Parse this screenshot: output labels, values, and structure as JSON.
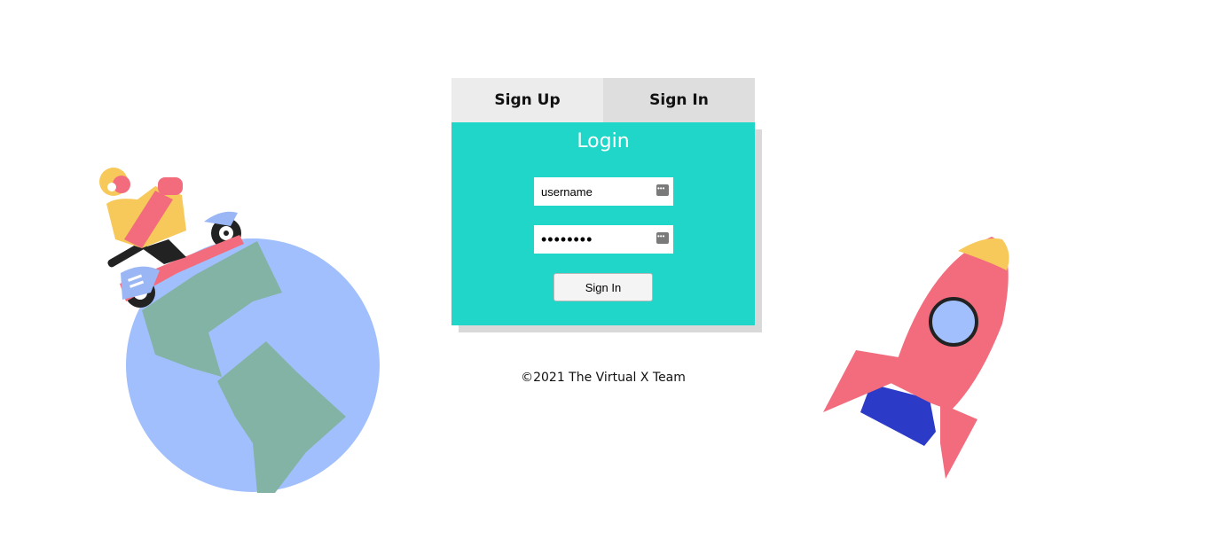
{
  "tabs": {
    "sign_up": "Sign Up",
    "sign_in": "Sign In"
  },
  "login": {
    "title": "Login",
    "username_value": "username",
    "password_value": "password",
    "submit_label": "Sign In"
  },
  "footer": {
    "copyright": "©2021 The Virtual X Team"
  },
  "colors": {
    "card": "#1fd6c9",
    "tab_signup": "#ececec",
    "tab_signin": "#dedede",
    "globe": "#a1bffc",
    "land": "#83b3a4",
    "rocket": "#f26c7d",
    "rocket_flame": "#2b3bc8"
  },
  "icons": {
    "left_illustration": "scooter-rider-on-globe-illustration",
    "right_illustration": "rocket-illustration",
    "field_icon": "password-manager-key-icon"
  }
}
